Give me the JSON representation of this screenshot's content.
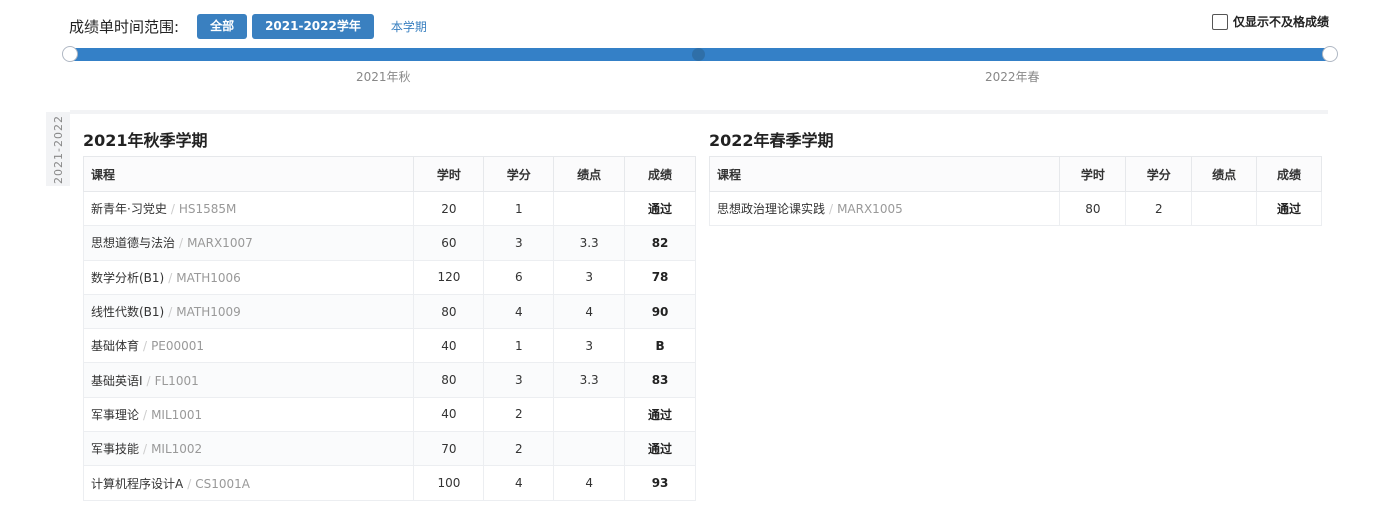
{
  "header": {
    "range_label": "成绩单时间范围:",
    "btn_all": "全部",
    "btn_year": "2021-2022学年",
    "link_semester": "本学期",
    "checkbox_label": "仅显示不及格成绩"
  },
  "timeline": {
    "tick_autumn": "2021年秋",
    "tick_spring": "2022年春"
  },
  "year_tab": "2021-2022",
  "columns": {
    "course": "课程",
    "hours": "学时",
    "credit": "学分",
    "gpa": "绩点",
    "score": "成绩"
  },
  "autumn": {
    "title": "2021年秋季学期",
    "rows": [
      {
        "name": "新青年·习党史",
        "code": "HS1585M",
        "hours": "20",
        "credit": "1",
        "gpa": "",
        "score": "通过"
      },
      {
        "name": "思想道德与法治",
        "code": "MARX1007",
        "hours": "60",
        "credit": "3",
        "gpa": "3.3",
        "score": "82"
      },
      {
        "name": "数学分析(B1)",
        "code": "MATH1006",
        "hours": "120",
        "credit": "6",
        "gpa": "3",
        "score": "78"
      },
      {
        "name": "线性代数(B1)",
        "code": "MATH1009",
        "hours": "80",
        "credit": "4",
        "gpa": "4",
        "score": "90"
      },
      {
        "name": "基础体育",
        "code": "PE00001",
        "hours": "40",
        "credit": "1",
        "gpa": "3",
        "score": "B"
      },
      {
        "name": "基础英语I",
        "code": "FL1001",
        "hours": "80",
        "credit": "3",
        "gpa": "3.3",
        "score": "83"
      },
      {
        "name": "军事理论",
        "code": "MIL1001",
        "hours": "40",
        "credit": "2",
        "gpa": "",
        "score": "通过"
      },
      {
        "name": "军事技能",
        "code": "MIL1002",
        "hours": "70",
        "credit": "2",
        "gpa": "",
        "score": "通过"
      },
      {
        "name": "计算机程序设计A",
        "code": "CS1001A",
        "hours": "100",
        "credit": "4",
        "gpa": "4",
        "score": "93"
      }
    ]
  },
  "spring": {
    "title": "2022年春季学期",
    "rows": [
      {
        "name": "思想政治理论课实践",
        "code": "MARX1005",
        "hours": "80",
        "credit": "2",
        "gpa": "",
        "score": "通过"
      }
    ]
  }
}
